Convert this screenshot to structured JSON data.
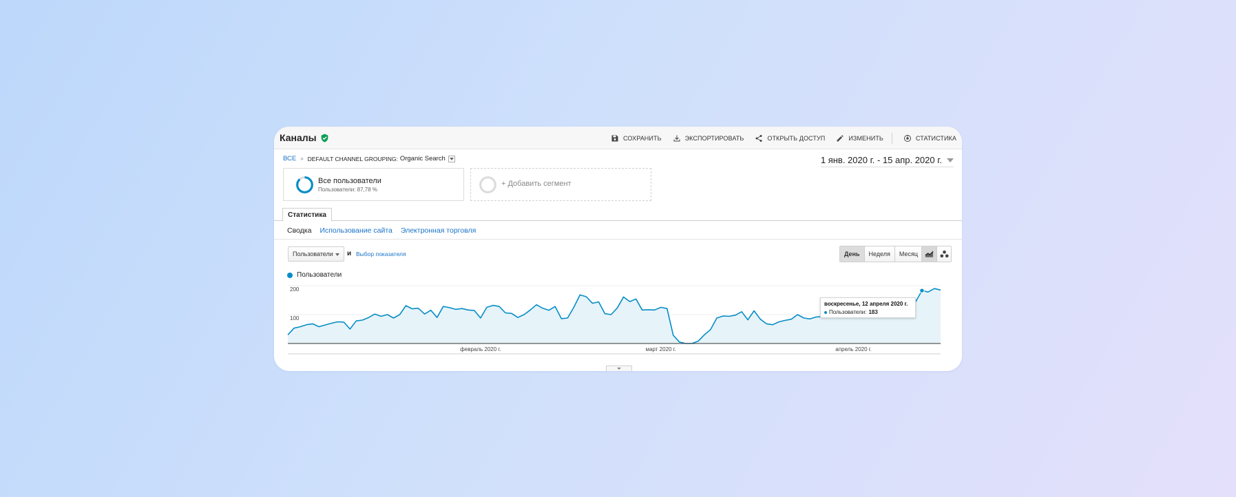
{
  "header": {
    "title": "Каналы",
    "actions": {
      "save": "СОХРАНИТЬ",
      "export": "ЭКСПОРТИРОВАТЬ",
      "share": "ОТКРЫТЬ ДОСТУП",
      "edit": "ИЗМЕНИТЬ",
      "insights": "СТАТИСТИКА"
    }
  },
  "breadcrumb": {
    "root": "ВСЕ",
    "dimension": "DEFAULT CHANNEL GROUPING:",
    "value": "Organic Search"
  },
  "date_range": "1 янв. 2020 г. - 15 апр. 2020 г.",
  "segments": {
    "primary_name": "Все пользователи",
    "primary_sub": "Пользователи: 87,78 %",
    "add_label": "+ Добавить сегмент"
  },
  "tab": "Статистика",
  "subnav": [
    "Сводка",
    "Использование сайта",
    "Электронная торговля"
  ],
  "metric_select": "Пользователи",
  "and_label": "и",
  "choose_metric": "Выбор показателя",
  "periods": [
    "День",
    "Неделя",
    "Месяц"
  ],
  "legend_label": "Пользователи",
  "tooltip": {
    "date": "воскресенье, 12 апреля 2020 г.",
    "metric": "Пользователи:",
    "value": "183"
  },
  "colors": {
    "series": "#058dc7",
    "fill": "#e6f3f9",
    "link": "#1a73c8",
    "verified": "#0f9d58"
  },
  "chart_data": {
    "type": "area",
    "title": "",
    "series": [
      {
        "name": "Пользователи"
      }
    ],
    "ylim": [
      0,
      200
    ],
    "yticks": [
      {
        "label": "200",
        "value": 200
      },
      {
        "label": "100",
        "value": 100
      }
    ],
    "x_labels": [
      {
        "label": "февраль 2020 г.",
        "index": 31
      },
      {
        "label": "март 2020 г.",
        "index": 60
      },
      {
        "label": "апрель 2020 г.",
        "index": 91
      }
    ],
    "values": [
      30,
      53,
      58,
      65,
      68,
      58,
      64,
      70,
      75,
      74,
      50,
      78,
      81,
      90,
      102,
      94,
      100,
      88,
      100,
      131,
      120,
      122,
      102,
      115,
      90,
      128,
      124,
      118,
      121,
      116,
      114,
      88,
      125,
      132,
      128,
      106,
      104,
      90,
      100,
      116,
      134,
      122,
      115,
      128,
      86,
      88,
      125,
      168,
      162,
      139,
      144,
      103,
      100,
      123,
      161,
      145,
      154,
      116,
      117,
      116,
      125,
      121,
      28,
      5,
      0,
      0,
      8,
      30,
      48,
      88,
      95,
      94,
      98,
      110,
      82,
      113,
      84,
      68,
      65,
      75,
      80,
      84,
      100,
      88,
      85,
      92,
      93,
      97,
      105,
      100,
      108,
      115,
      115,
      96,
      120,
      118,
      136,
      130,
      143,
      140,
      150,
      145,
      183,
      178,
      190,
      185
    ]
  }
}
